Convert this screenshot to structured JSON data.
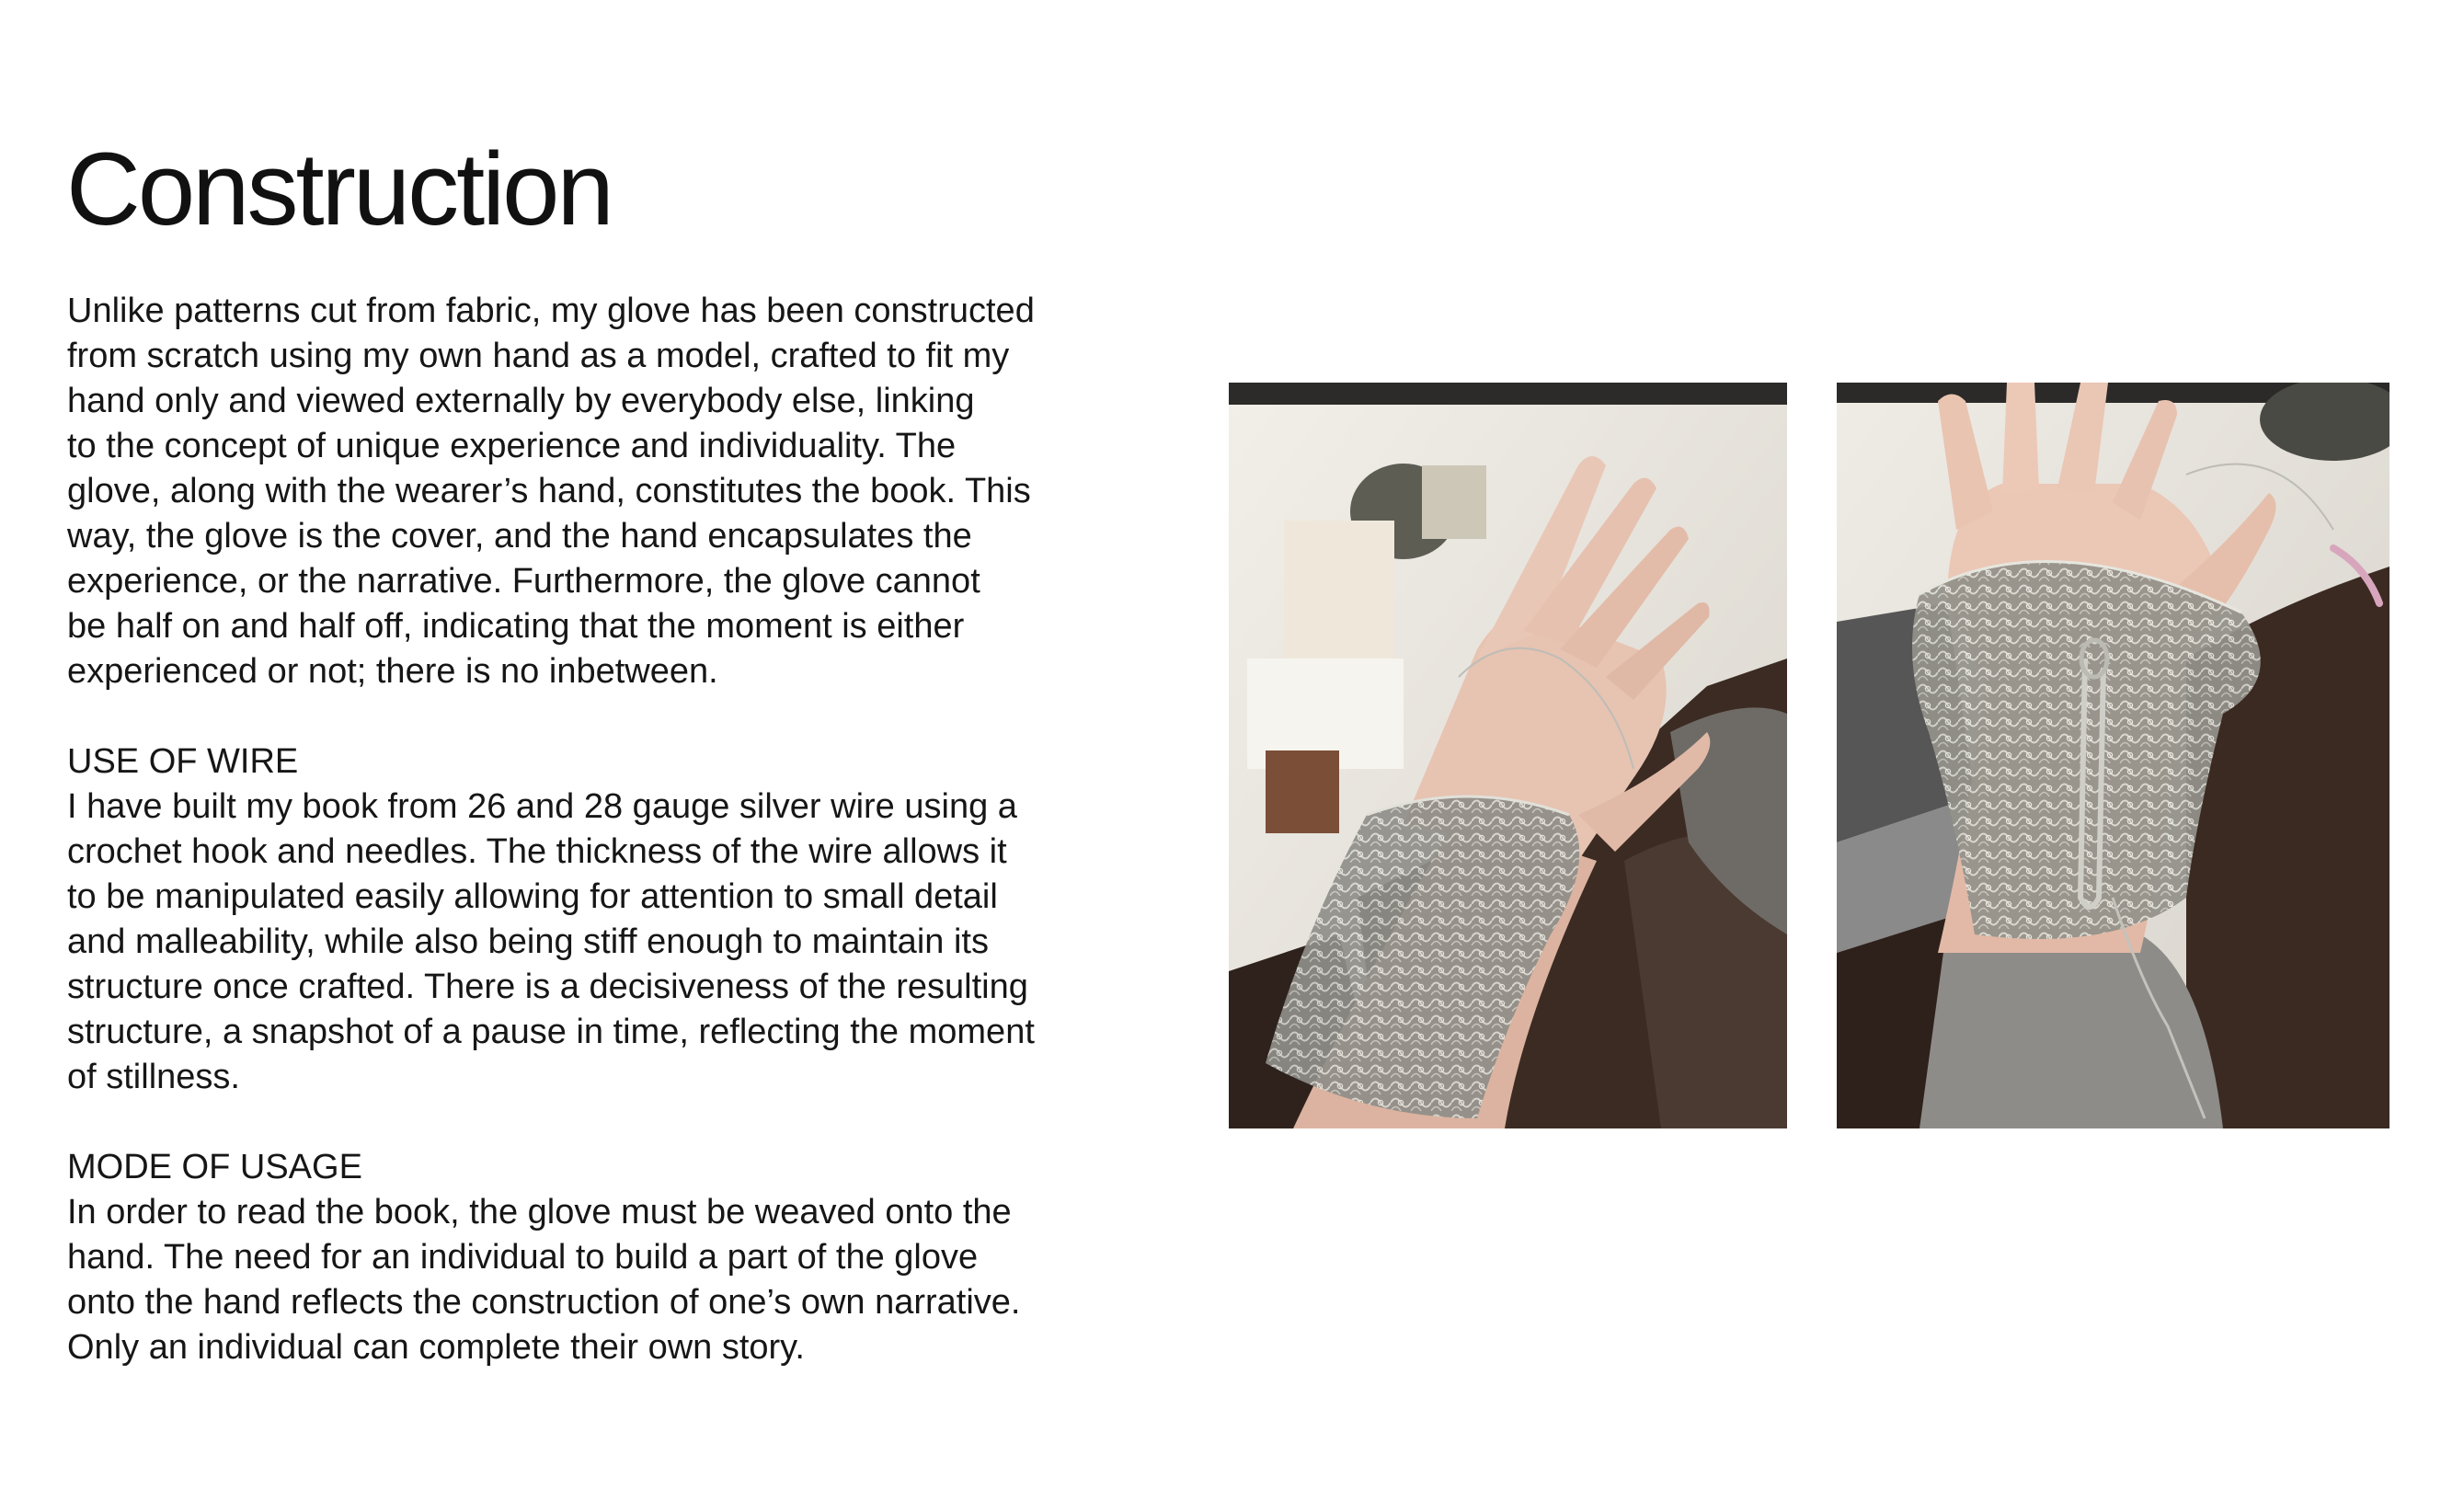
{
  "page": {
    "title": "Construction"
  },
  "intro": {
    "text": "Unlike patterns cut from fabric, my glove has been constructed\nfrom scratch using my own hand as a model, crafted to fit my\nhand only and viewed externally by everybody else, linking\nto the concept of unique experience and individuality. The\nglove, along with the wearer’s hand, constitutes the book. This\nway, the glove is the cover, and the hand encapsulates the\nexperience, or the narrative. Furthermore, the glove cannot\nbe half on and half off, indicating that the moment is either\nexperienced or not; there is no inbetween."
  },
  "wire_section": {
    "heading": "USE OF WIRE",
    "text": "I have built my book from 26 and 28 gauge silver wire using a\ncrochet hook and needles. The thickness of the wire allows it\nto be manipulated easily allowing for attention to small detail\nand malleability, while also being stiff enough to maintain its\nstructure once crafted. There is a decisiveness of the resulting\nstructure, a snapshot of a pause in time, reflecting the moment\nof stillness."
  },
  "usage_section": {
    "heading": "MODE OF USAGE",
    "text": "In order to read the book, the glove must be weaved onto the\nhand. The need for an individual to build a part of the glove\nonto the hand reflects the construction of one’s own narrative.\nOnly an individual can complete their own story."
  },
  "colors": {
    "text": "#161616",
    "background": "#ffffff",
    "blanket": "#3a2a22",
    "sheet": "#e9e6df",
    "skin": "#e4bfae",
    "wire": "#a9a9a2",
    "sleeve": "#8d8b88"
  }
}
